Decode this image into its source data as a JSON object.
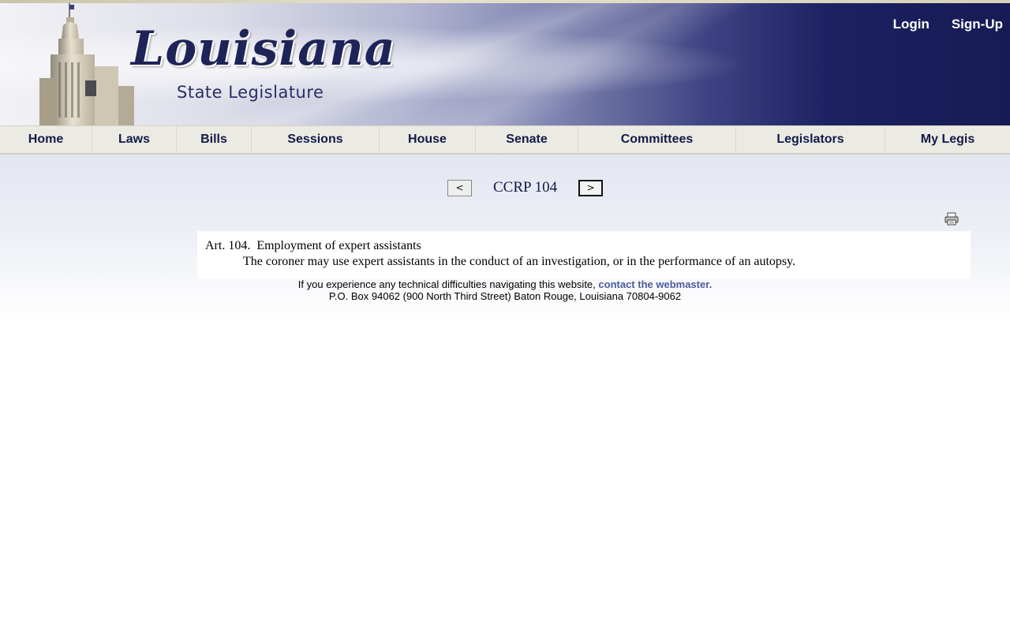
{
  "header": {
    "logo_title": "Louisiana",
    "logo_subtitle": "State Legislature",
    "auth_links": [
      "Login",
      "Sign-Up"
    ]
  },
  "nav": {
    "items": [
      {
        "label": "Home"
      },
      {
        "label": "Laws"
      },
      {
        "label": "Bills"
      },
      {
        "label": "Sessions"
      },
      {
        "label": "House"
      },
      {
        "label": "Senate"
      },
      {
        "label": "Committees"
      },
      {
        "label": "Legislators"
      },
      {
        "label": "My Legis"
      }
    ]
  },
  "pager": {
    "prev_label": "<",
    "next_label": ">",
    "title": "CCRP 104"
  },
  "document": {
    "heading": "Art. 104.  Employment of expert assistants",
    "body": "The coroner may use expert assistants in the conduct of an investigation, or in the performance of an autopsy."
  },
  "footer": {
    "help_text": "If you experience any technical difficulties navigating this website,",
    "contact_link": "contact the webmaster.",
    "address": "P.O. Box 94062 (900 North Third Street) Baton Rouge, Louisiana 70804-9062"
  },
  "icons": {
    "print": "print-icon"
  }
}
